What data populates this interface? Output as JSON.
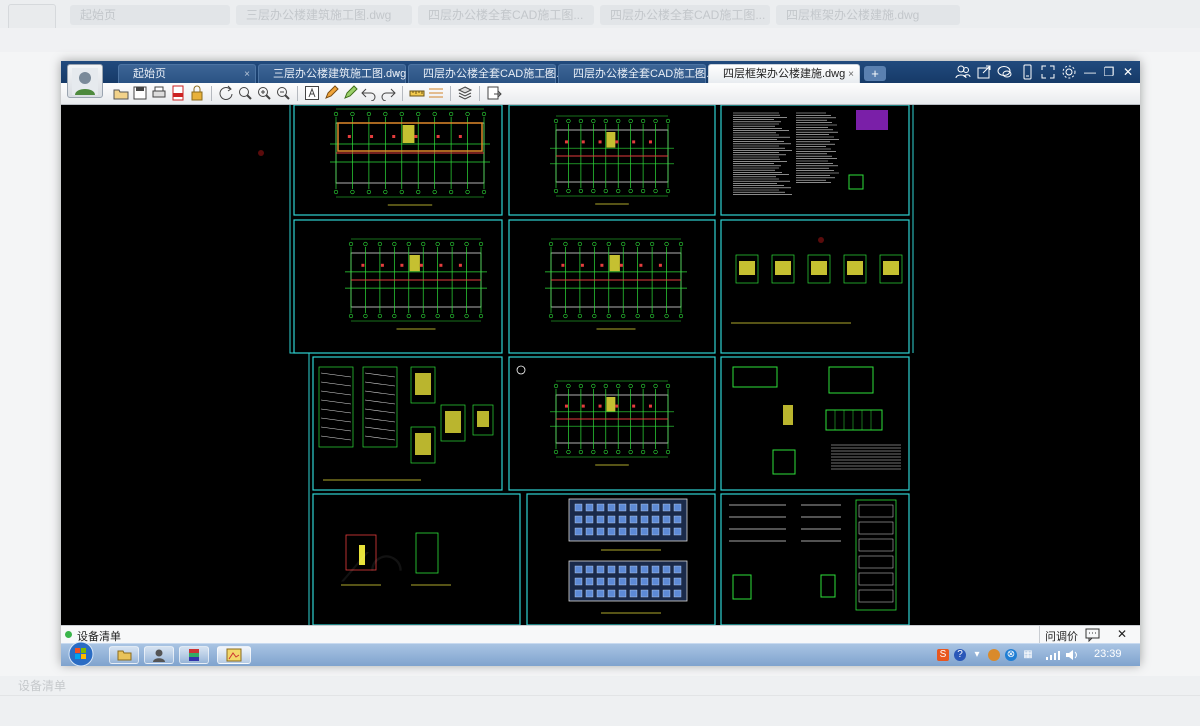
{
  "app": {
    "tabs": [
      {
        "label": "起始页"
      },
      {
        "label": "三层办公楼建筑施工图.dwg"
      },
      {
        "label": "四层办公楼全套CAD施工图..."
      },
      {
        "label": "四层办公楼全套CAD施工图..."
      },
      {
        "label": "四层框架办公楼建施.dwg"
      }
    ],
    "active_tab": 4,
    "add_tab_label": "+",
    "tab_close_glyph": "×",
    "window_controls": {
      "minimize": "—",
      "restore": "❐",
      "close": "✕"
    },
    "title_icons": [
      "user-group-icon",
      "share-icon",
      "chat-icon",
      "phone-icon",
      "fullscreen-icon",
      "settings-icon"
    ]
  },
  "toolbar": {
    "groups": [
      [
        "open-icon",
        "save-icon",
        "print-icon",
        "pdf-icon",
        "lock-icon"
      ],
      [
        "rotate-icon",
        "zoom-window-icon",
        "zoom-in-icon",
        "zoom-out-icon"
      ],
      [
        "text-icon",
        "pencil-icon",
        "marker-icon",
        "undo-icon",
        "redo-icon"
      ],
      [
        "measure-icon",
        "dimension-icon"
      ],
      [
        "layers-icon"
      ],
      [
        "export-icon"
      ]
    ]
  },
  "statusbar": {
    "left_label": "设备清单",
    "help_label": "问调价"
  },
  "taskbar": {
    "start_label": "start-orb",
    "clock": "23:39"
  },
  "colors": {
    "title_bar": "#1b416f",
    "canvas": "#000000",
    "frame_cyan": "#2fd3d3",
    "line_green": "#2ee03a",
    "line_red": "#e43d3d",
    "line_yellow": "#e8e23a",
    "line_white": "#dddddd"
  }
}
